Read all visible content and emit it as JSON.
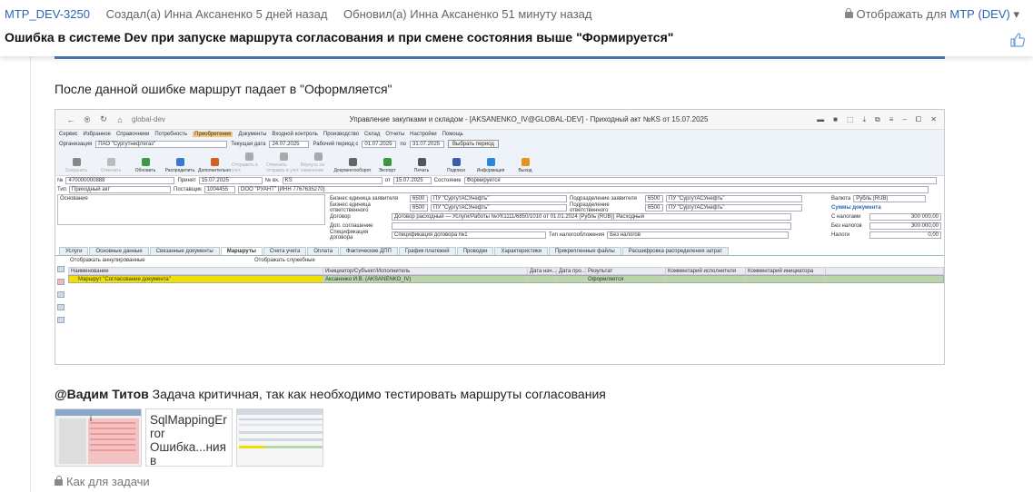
{
  "issue": {
    "key": "MTP_DEV-3250",
    "created": "Создал(а) Инна Аксаненко 5 дней назад",
    "updated": "Обновил(а) Инна Аксаненко 51 минуту назад",
    "visibility_label": "Отображать для",
    "visibility_value": "МТР (DEV)",
    "title": "Ошибка в системе Dev при запуске маршрута согласования и при смене состояния выше \"Формируется\""
  },
  "comment": {
    "text": "После данной ошибке маршрут падает в \"Оформляется\"",
    "mention_user": "@Вадим Титов",
    "mention_text": " Задача критичная, так как необходимо тестировать маршруты согласования",
    "attachment_doc": "SqlMappingError Ошибка...ния в Stm_ActIn.docx",
    "private_label": "Как для задачи"
  },
  "screenshot": {
    "url": "global-dev",
    "window_title": "Управление закупками и складом - [AKSANENKO_IV@GLOBAL-DEV] - Приходный акт №KS от 15.07.2025",
    "menu": [
      "Сервис",
      "Избранное",
      "Справочники",
      "Потребность",
      "Приобретение",
      "Документы",
      "Входной контроль",
      "Производство",
      "Склад",
      "Отчеты",
      "Настройки",
      "Помощь"
    ],
    "org_label": "Организация",
    "org_value": "ПАО \"Сургутнефтегаз\"",
    "date_label": "Текущая дата",
    "date_value": "24.07.2025",
    "period_label": "Рабочий период с",
    "period_from": "01.07.2025",
    "period_to_label": "по",
    "period_to": "31.07.2025",
    "period_btn": "Выбрать период",
    "tools": [
      "Сохранить",
      "Отменить",
      "Обновить",
      "Распределить",
      "Дополнительно",
      "Отправить в учет",
      "Отменить отправку в учет",
      "Вернуть на изменение",
      "Документооборот",
      "Экспорт",
      "Печать",
      "Подписи",
      "Информация",
      "Выход"
    ],
    "num_label": "№",
    "num_value": "470000000888",
    "accepted_label": "Принят",
    "accepted_value": "15.07.2025",
    "vh_label": "№ вх.",
    "vh_value": "KS",
    "from_label": "от",
    "from_value": "15.07.2025",
    "state_label": "Состояние",
    "state_value": "Формируется",
    "type_label": "Тип",
    "type_value": "Приходный акт",
    "supplier_label": "Поставщик",
    "supplier_code": "1004455",
    "supplier_name": "ООО \"РУАНТ\" (ИНН 7767635270)",
    "basis_label": "Основание",
    "bu_req_label": "Бизнес единица заявителя",
    "bu_req_code": "6500",
    "bu_req_name": "ПУ \"СургутАСУнефть\"",
    "bu_resp_label": "Бизнес единица ответственного",
    "bu_resp_code": "6500",
    "bu_resp_name": "ПУ \"СургутАСУнефть\"",
    "sub_req_label": "Подразделение заявителя",
    "sub_req_code": "6500",
    "sub_req_name": "ПУ \"СургутАСУнефть\"",
    "sub_resp_label": "Подразделение ответственного",
    "sub_resp_code": "6500",
    "sub_resp_name": "ПУ \"СургутАСУнефть\"",
    "contract_label": "Договор",
    "contract_value": "Договор расходный — Услуги/Работы №УК1111/6850/1010 от 01.01.2024 (Рубль (RUB)) Расходный",
    "addagr_label": "Доп. соглашение",
    "spec_label": "Спецификация договора",
    "spec_value": "Спецификация договора №1",
    "tax_label": "Тип налогообложения",
    "tax_value": "Без налогов",
    "currency_label": "Валюта",
    "currency_value": "Рубль (RUB)",
    "sums_header": "Суммы документа",
    "sums": [
      {
        "label": "С налогами",
        "value": "300 000,00"
      },
      {
        "label": "Без налогов",
        "value": "300 000,00"
      },
      {
        "label": "Налоги",
        "value": "0,00"
      }
    ],
    "tabs": [
      "Услуги",
      "Основные данные",
      "Связанные документы",
      "Маршруты",
      "Счета учета",
      "Оплата",
      "Фактические ДПП",
      "График платежей",
      "Проводки",
      "Характеристики",
      "Прикрепленные файлы",
      "Расшифровка распределения затрат"
    ],
    "active_tab": "Маршруты",
    "show_cancelled": "Отображать аннулированные",
    "show_service": "Отображать служебные",
    "grid_headers": [
      "Наименование",
      "Инициатор/Субъект/Исполнитель",
      "Дата нач...",
      "Дата про...",
      "Результат",
      "Комментарий исполнителя",
      "Комментарий инициатора"
    ],
    "grid_row": [
      "Маршрут \"Согласование документа\"",
      "Аксаненко И.В. (AKSANENKO_IV)",
      "",
      "",
      "Оформляется",
      "",
      ""
    ]
  },
  "colors": {
    "accent": "#2a66b8",
    "highlight": "#f0e000",
    "rowgreen": "#b8d7a8"
  }
}
